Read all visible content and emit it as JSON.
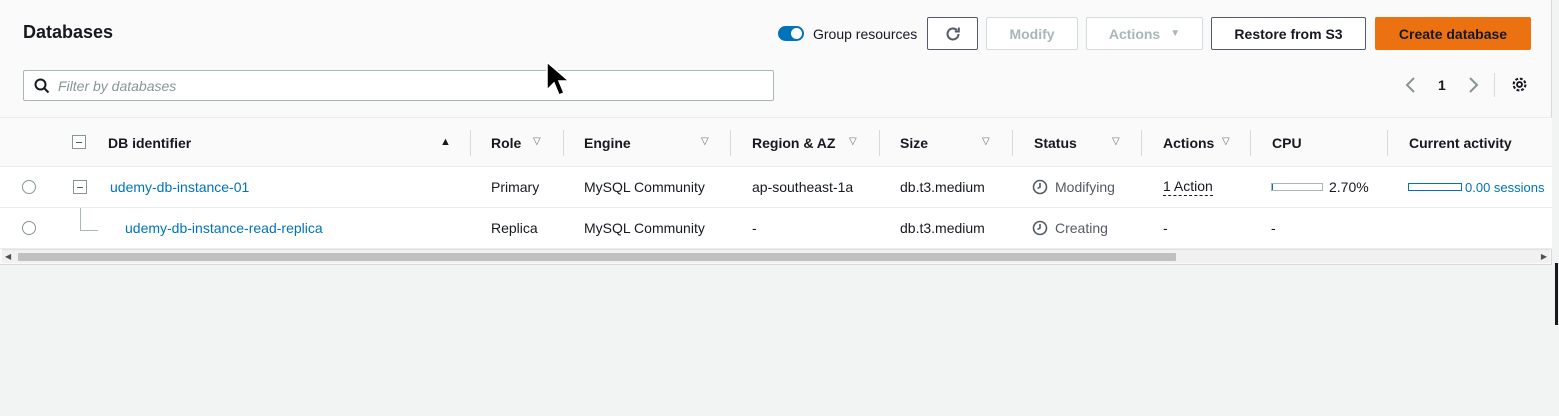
{
  "header": {
    "title": "Databases",
    "group_resources_label": "Group resources",
    "modify_label": "Modify",
    "actions_label": "Actions",
    "restore_label": "Restore from S3",
    "create_label": "Create database"
  },
  "search": {
    "placeholder": "Filter by databases"
  },
  "pagination": {
    "current_page": "1"
  },
  "columns": {
    "db_identifier": "DB identifier",
    "role": "Role",
    "engine": "Engine",
    "region": "Region & AZ",
    "size": "Size",
    "status": "Status",
    "actions": "Actions",
    "cpu": "CPU",
    "activity": "Current activity"
  },
  "rows": [
    {
      "identifier": "udemy-db-instance-01",
      "role": "Primary",
      "engine": "MySQL Community",
      "region": "ap-southeast-1a",
      "size": "db.t3.medium",
      "status": "Modifying",
      "actions": "1 Action",
      "cpu": "2.70%",
      "cpu_fraction": 0.027,
      "activity": "0.00 sessions",
      "activity_fraction": 0.0
    },
    {
      "identifier": "udemy-db-instance-read-replica",
      "role": "Replica",
      "engine": "MySQL Community",
      "region": "-",
      "size": "db.t3.medium",
      "status": "Creating",
      "actions": "-",
      "cpu": "-"
    }
  ],
  "colors": {
    "accent": "#0073bb",
    "primary_button": "#ec7211"
  },
  "icons": {
    "search": "search-icon",
    "refresh": "refresh-icon",
    "settings": "gear-icon",
    "status": "clock-icon"
  }
}
